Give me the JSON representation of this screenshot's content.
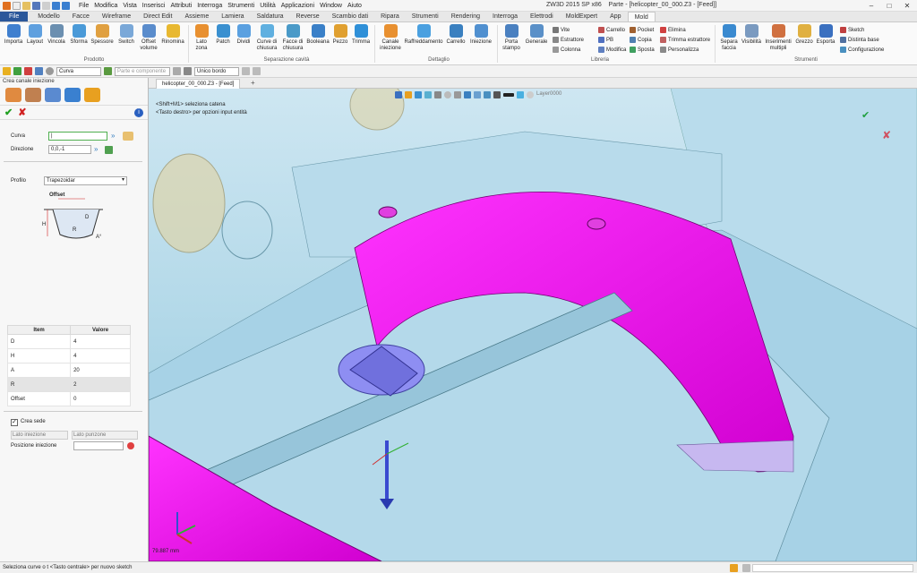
{
  "window": {
    "title": "ZW3D 2015 SP x86",
    "doc_title": "Parte - [helicopter_00_000.Z3 - [Feed]]"
  },
  "menu": [
    "File",
    "Modifica",
    "Vista",
    "Inserisci",
    "Attributi",
    "Interroga",
    "Strumenti",
    "Utilità",
    "Applicazioni",
    "Window",
    "Aiuto"
  ],
  "tabs": [
    "File",
    "Modello",
    "Facce",
    "Wireframe",
    "Direct Edit",
    "Assieme",
    "Lamiera",
    "Saldatura",
    "Reverse",
    "Scambio dati",
    "Ripara",
    "Strumenti",
    "Rendering",
    "Interroga",
    "Elettrodi",
    "MoldExpert",
    "App",
    "Mold"
  ],
  "ribbon": {
    "prodotto": [
      "Importa",
      "Layout",
      "Vincola",
      "Sforma",
      "Spessore",
      "Switch",
      "Offset volume",
      "Rinomina"
    ],
    "separazione": [
      "Lato zona",
      "Patch",
      "Dividi",
      "Curve di chiusura",
      "Facce di chiusura",
      "Booleana",
      "Pezzo",
      "Trimma"
    ],
    "dettaglio": [
      "Canale iniezione",
      "Raffreddamento",
      "Carrello",
      "Iniezione"
    ],
    "libreria_big": [
      "Porta stampo",
      "Generale"
    ],
    "libreria_small": [
      "Vite",
      "Estrattore",
      "Colonna",
      "Carrello",
      "PB",
      "Modifica",
      "Pocket",
      "Copia",
      "Sposta",
      "Elimina",
      "Trimma estrattore",
      "Personalizza"
    ],
    "strumenti": [
      "Separa faccia",
      "Visibilità",
      "Inserimenti multipli",
      "Grezzo",
      "Esporta"
    ],
    "strumenti_small": [
      "Sketch",
      "Distinta base",
      "Configurazione"
    ],
    "groups": [
      "Prodotto",
      "Separazione cavità",
      "Dettaglio",
      "Libreria",
      "Strumenti"
    ]
  },
  "toolbar2": {
    "filter": "Curva",
    "part_placeholder": "Parte e componente",
    "edge": "Unico bordo"
  },
  "panel": {
    "title": "Crea canale iniezione",
    "curva_label": "Curva",
    "curva_value": "|",
    "direzione_label": "Direzione",
    "direzione_value": "0,0,-1",
    "profilo_label": "Profilo",
    "profilo_value": "Trapezoidar",
    "offset_label": "Offset",
    "table_headers": [
      "Item",
      "Valore"
    ],
    "rows": [
      {
        "item": "D",
        "value": "4"
      },
      {
        "item": "H",
        "value": "4"
      },
      {
        "item": "A",
        "value": "20"
      },
      {
        "item": "R",
        "value": "2"
      },
      {
        "item": "Offset",
        "value": "0"
      }
    ],
    "crea_sede": "Crea sede",
    "lato_iniezione": "Lato iniezione",
    "lato_punzone": "Lato punzone",
    "posizione_iniezione": "Posizione iniezione"
  },
  "viewport": {
    "tab": "helicopter_00_000.Z3 - [Feed]",
    "hint1": "<Shift+M1> seleziona catena",
    "hint2": "<Tasto destro> per opzioni input entità",
    "layer": "Layer0000",
    "scale": "79.887 mm"
  },
  "status": "Seleziona curve o t <Tasto centrale> per nuovo sketch",
  "colors": {
    "magenta": "#ff00ff",
    "blue_part": "#a9d6ea",
    "accent": "#2b579a",
    "valve": "#8080ee"
  }
}
